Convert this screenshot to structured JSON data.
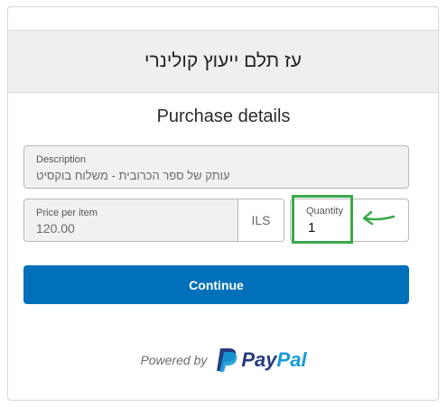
{
  "header": {
    "title": "עז תלם ייעוץ קולינרי"
  },
  "form": {
    "title": "Purchase details",
    "description": {
      "label": "Description",
      "value": "עותק של ספר הכרובית - משלוח בוקסיט"
    },
    "price": {
      "label": "Price per item",
      "value": "120.00",
      "currency": "ILS"
    },
    "quantity": {
      "label": "Quantity",
      "value": "1"
    },
    "continue_label": "Continue"
  },
  "footer": {
    "powered_by": "Powered by",
    "brand_pay": "Pay",
    "brand_pal": "Pal"
  },
  "colors": {
    "button": "#0070ba",
    "highlight": "#39a94a",
    "paypal_dark": "#253b80",
    "paypal_light": "#179bd7"
  },
  "icons": {
    "logo": "paypal-p-icon",
    "annotation": "arrow-left-icon"
  }
}
